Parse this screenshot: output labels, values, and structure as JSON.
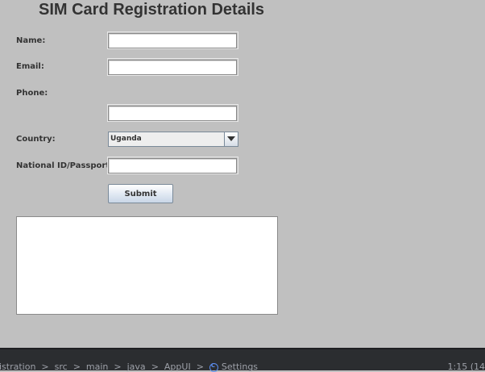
{
  "window": {
    "title": "SIM Card Registration Details"
  },
  "form": {
    "name_label": "Name:",
    "name_value": "",
    "email_label": "Email:",
    "email_value": "",
    "phone_label": "Phone:",
    "phone_value": "",
    "country_label": "Country:",
    "country_selected": "Uganda",
    "id_label": "National ID/Passport:",
    "id_value": "",
    "submit_label": "Submit"
  },
  "output": {
    "text": ""
  },
  "statusbar": {
    "breadcrumbs": [
      "gistration",
      "src",
      "main",
      "java",
      "AppUI",
      "Settings"
    ],
    "separator": ">",
    "cursor_position": "1:15 (14"
  },
  "colors": {
    "background": "#c0c0c0",
    "statusbar": "#2b2d30",
    "settings_icon": "#5b8def"
  },
  "icons": {
    "combo_arrow": "chevron-down-icon",
    "settings": "class-icon"
  }
}
